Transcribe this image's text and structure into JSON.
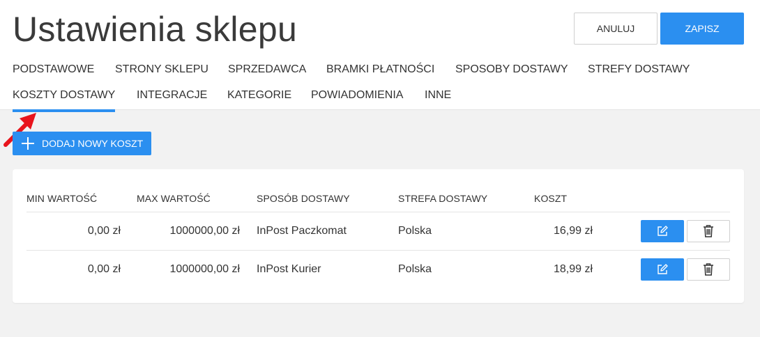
{
  "header": {
    "title": "Ustawienia sklepu",
    "cancel_label": "ANULUJ",
    "save_label": "ZAPISZ"
  },
  "tabs": [
    {
      "label": "PODSTAWOWE",
      "active": false
    },
    {
      "label": "STRONY SKLEPU",
      "active": false
    },
    {
      "label": "SPRZEDAWCA",
      "active": false
    },
    {
      "label": "BRAMKI PŁATNOŚCI",
      "active": false
    },
    {
      "label": "SPOSOBY DOSTAWY",
      "active": false
    },
    {
      "label": "STREFY DOSTAWY",
      "active": false
    },
    {
      "label": "KOSZTY DOSTAWY",
      "active": true
    },
    {
      "label": "INTEGRACJE",
      "active": false
    },
    {
      "label": "KATEGORIE",
      "active": false
    },
    {
      "label": "POWIADOMIENIA",
      "active": false
    },
    {
      "label": "INNE",
      "active": false
    }
  ],
  "add_button_label": "DODAJ NOWY KOSZT",
  "table": {
    "columns": [
      "MIN WARTOŚĆ",
      "MAX WARTOŚĆ",
      "SPOSÓB DOSTAWY",
      "STREFA DOSTAWY",
      "KOSZT"
    ],
    "rows": [
      {
        "min": "0,00 zł",
        "max": "1000000,00 zł",
        "method": "InPost Paczkomat",
        "zone": "Polska",
        "cost": "16,99 zł"
      },
      {
        "min": "0,00 zł",
        "max": "1000000,00 zł",
        "method": "InPost Kurier",
        "zone": "Polska",
        "cost": "18,99 zł"
      }
    ]
  },
  "icons": {
    "add": "plus-icon",
    "edit": "edit-icon",
    "delete": "trash-icon",
    "annotation": "red-arrow-icon"
  },
  "colors": {
    "primary": "#2b8ff0",
    "annotation": "#e8141c",
    "background": "#f2f2f2"
  }
}
